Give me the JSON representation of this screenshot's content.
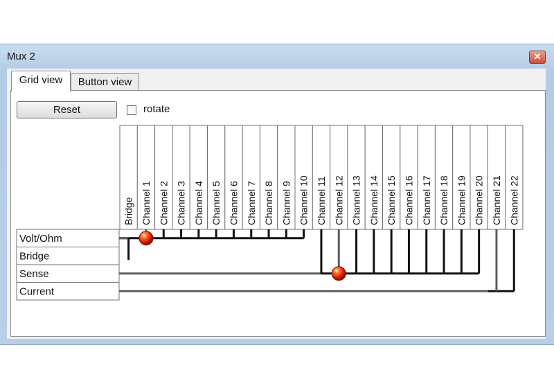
{
  "window": {
    "title": "Mux 2",
    "close_glyph": "✕"
  },
  "tabs": [
    {
      "label": "Grid view",
      "selected": true
    },
    {
      "label": "Button view",
      "selected": false
    }
  ],
  "controls": {
    "reset_label": "Reset",
    "rotate_label": "rotate",
    "rotate_checked": false
  },
  "grid": {
    "columns": [
      "Bridge",
      "Channel 1",
      "Channel 2",
      "Channel 3",
      "Channel 4",
      "Channel 5",
      "Channel 6",
      "Channel 7",
      "Channel 8",
      "Channel 9",
      "Channel 10",
      "Channel 11",
      "Channel 12",
      "Channel 13",
      "Channel 14",
      "Channel 15",
      "Channel 16",
      "Channel 17",
      "Channel 18",
      "Channel 19",
      "Channel 20",
      "Channel 21",
      "Channel 22"
    ],
    "rows": [
      "Volt/Ohm",
      "Bridge",
      "Sense",
      "Current"
    ],
    "connections": [
      {
        "row": "Volt/Ohm",
        "column": "Channel 1"
      },
      {
        "row": "Sense",
        "column": "Channel 12"
      }
    ]
  }
}
